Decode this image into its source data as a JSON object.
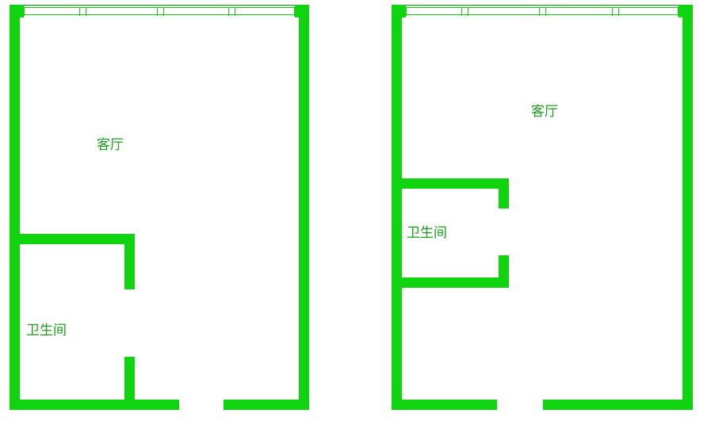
{
  "plan_left": {
    "living_room": {
      "label": "客厅",
      "sub": ""
    },
    "bathroom": {
      "label": "卫生间",
      "sub": ""
    }
  },
  "plan_right": {
    "living_room": {
      "label": "客厅",
      "sub": ""
    },
    "bathroom": {
      "label": "卫生间",
      "sub": ""
    }
  },
  "colors": {
    "wall": "#0fd40f",
    "text": "#1b9e1b"
  }
}
